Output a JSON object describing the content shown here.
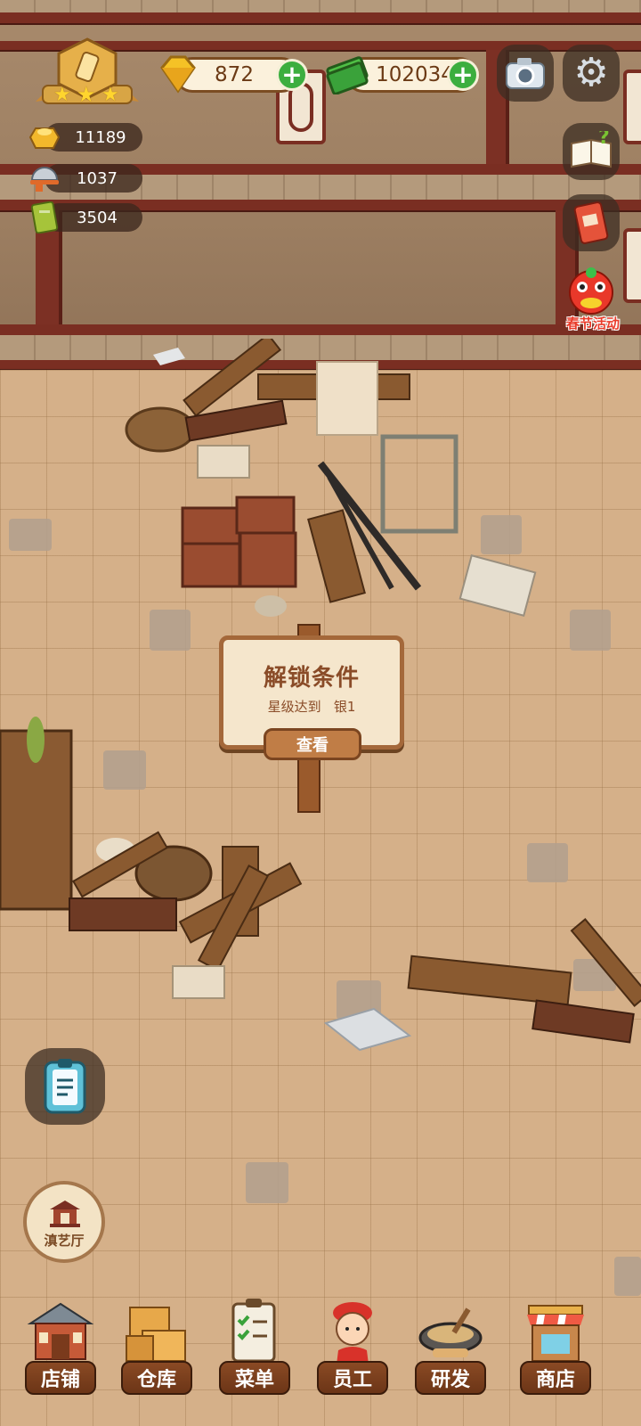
{
  "currencies": {
    "gems": "872",
    "cash": "102034",
    "plus_symbol": "+"
  },
  "stats": {
    "gold": "11189",
    "dishes": "1037",
    "recipes": "3504"
  },
  "rating": {
    "stars": 3
  },
  "side_buttons": {
    "event_label": "春节活动"
  },
  "unlock_sign": {
    "title": "解锁条件",
    "requirement": "星级达到   银1",
    "view_label": "查看"
  },
  "theater": {
    "label": "滇艺厅"
  },
  "nav": {
    "shop_front": "店铺",
    "warehouse": "仓库",
    "menu": "菜单",
    "staff": "员工",
    "research": "研发",
    "store": "商店"
  },
  "colors": {
    "accent_green": "#3cae3f",
    "beam_red": "#7a2e22",
    "floor": "#d5b089",
    "nav_brown": "#6c3517"
  }
}
